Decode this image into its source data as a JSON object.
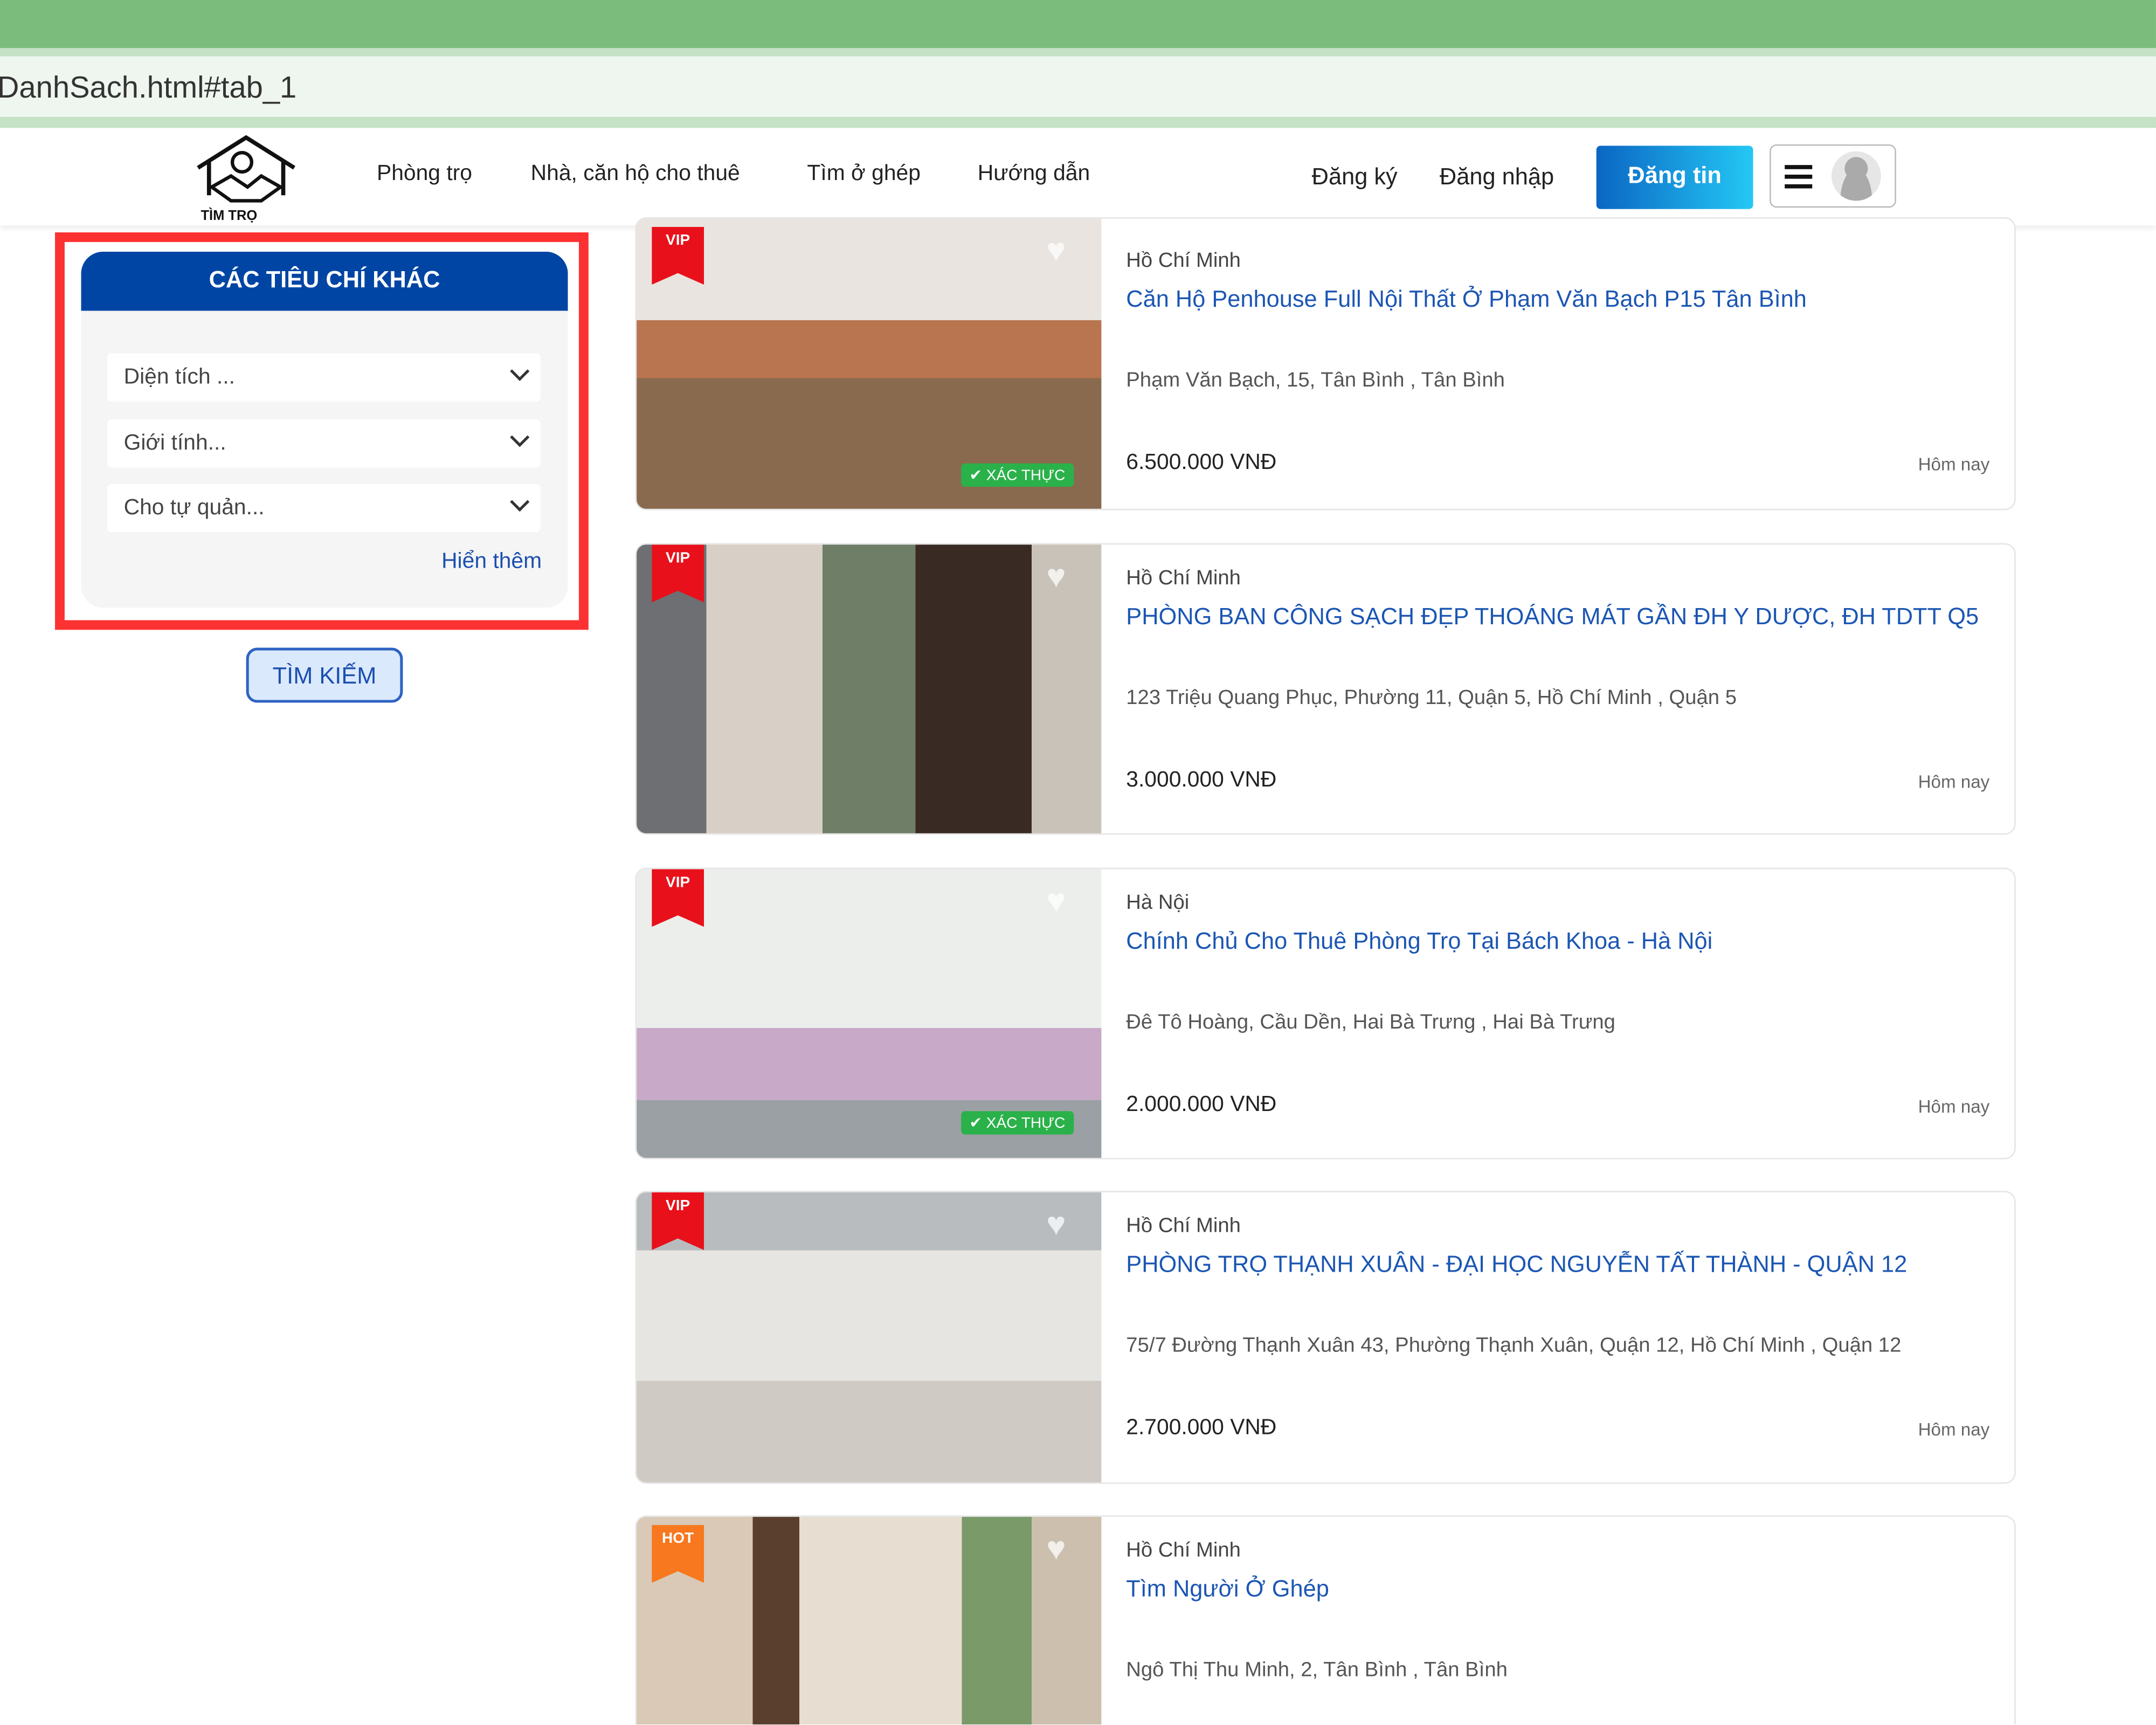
{
  "browser": {
    "url": "DanhSach.html#tab_1"
  },
  "nav": {
    "logo_text": "TÌM TRỌ",
    "links": [
      "Phòng trọ",
      "Nhà, căn hộ cho thuê",
      "Tìm ở ghép",
      "Hướng dẫn"
    ],
    "register": "Đăng ký",
    "login": "Đăng nhập",
    "post": "Đăng tin"
  },
  "filter": {
    "title": "CÁC TIÊU CHÍ KHÁC",
    "selects": [
      "Diện tích ...",
      "Giới tính...",
      "Cho tự quản..."
    ],
    "more": "Hiển thêm",
    "search": "TÌM KIẾM"
  },
  "listings": [
    {
      "badge": "VIP",
      "verified": "XÁC THỰC",
      "city": "Hồ Chí Minh",
      "title": "Căn Hộ Penhouse Full Nội Thất Ở Phạm Văn Bạch P15 Tân Bình",
      "address": "Phạm Văn Bạch, 15, Tân Bình , Tân Bình",
      "price": "6.500.000 VNĐ",
      "time": "Hôm nay"
    },
    {
      "badge": "VIP",
      "city": "Hồ Chí Minh",
      "title": "PHÒNG BAN CÔNG SẠCH ĐẸP THOÁNG MÁT GẦN ĐH Y DƯỢC, ĐH TDTT Q5",
      "address": "123 Triệu Quang Phục, Phường 11, Quận 5, Hồ Chí Minh , Quận 5",
      "price": "3.000.000 VNĐ",
      "time": "Hôm nay"
    },
    {
      "badge": "VIP",
      "verified": "XÁC THỰC",
      "city": "Hà Nội",
      "title": "Chính Chủ Cho Thuê Phòng Trọ Tại Bách Khoa - Hà Nội",
      "address": "Đê Tô Hoàng, Cầu Dền, Hai Bà Trưng , Hai Bà Trưng",
      "price": "2.000.000 VNĐ",
      "time": "Hôm nay"
    },
    {
      "badge": "VIP",
      "city": "Hồ Chí Minh",
      "title": "PHÒNG TRỌ THẠNH XUÂN - ĐẠI HỌC NGUYỄN TẤT THÀNH - QUẬN 12",
      "address": "75/7 Đường Thạnh Xuân 43, Phường Thạnh Xuân, Quận 12, Hồ Chí Minh , Quận 12",
      "price": "2.700.000 VNĐ",
      "time": "Hôm nay"
    },
    {
      "badge": "HOT",
      "city": "Hồ Chí Minh",
      "title": "Tìm Người Ở Ghép",
      "address": "Ngô Thị Thu Minh, 2, Tân Bình , Tân Bình"
    }
  ],
  "colors": {
    "vip": "#e8101a",
    "hot": "#f7781f",
    "accent": "#0045a4"
  }
}
